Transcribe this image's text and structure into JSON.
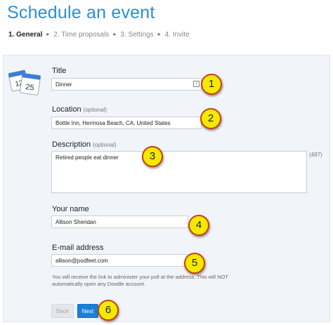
{
  "page": {
    "title": "Schedule an event"
  },
  "steps": [
    {
      "label": "1. General"
    },
    {
      "label": "2. Time proposals"
    },
    {
      "label": "3. Settings"
    },
    {
      "label": "4. Invite"
    }
  ],
  "calendar_icon": {
    "numbers": [
      "12",
      "25"
    ]
  },
  "form": {
    "title": {
      "label": "Title",
      "value": "Dinner"
    },
    "location": {
      "label": "Location",
      "optional": "(optional)",
      "value": "Bottle Inn, Hermosa Beach, CA, United States"
    },
    "description": {
      "label": "Description",
      "optional": "(optional)",
      "value": "Retired people eat dinner",
      "counter": "(487)"
    },
    "name": {
      "label": "Your name",
      "value": "Allison Sheridan"
    },
    "email": {
      "label": "E-mail address",
      "value": "allison@podfeet.com",
      "hint": "You will receive the link to administer your poll at the address. This will NOT automatically open any Doodle account."
    }
  },
  "buttons": {
    "back": "Back",
    "next": "Next"
  },
  "annotations": [
    "1",
    "2",
    "3",
    "4",
    "5",
    "6"
  ],
  "colors": {
    "accent": "#2a8fd6",
    "badge_fill": "#f5e900",
    "badge_border": "#c8420f",
    "next_button": "#1a7fd8"
  }
}
